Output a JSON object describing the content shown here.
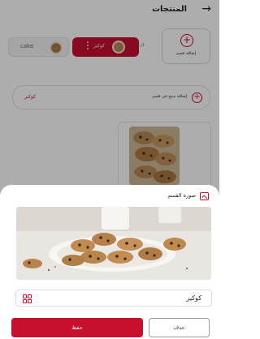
{
  "header": {
    "title": "المنتجات",
    "back_icon": "arrow-right-icon"
  },
  "categories": {
    "add_label": "إضافة قسم",
    "all_label": "ال",
    "active_chip": {
      "label": "كوكيز"
    },
    "other_chip": {
      "label": "cake"
    }
  },
  "section": {
    "category_name": "كوكيز",
    "add_product_label": "إضافة منتج في قسم"
  },
  "sheet": {
    "title": "صورة القسم",
    "name_value": "كوكيز",
    "save_label": "حفظ",
    "delete_label": "حذف"
  },
  "colors": {
    "accent": "#c8102e",
    "overlay": "rgba(0,0,0,0.32)"
  }
}
